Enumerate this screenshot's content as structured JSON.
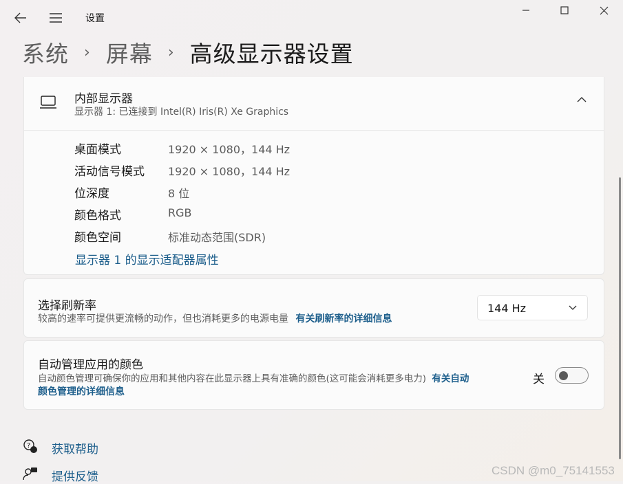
{
  "window": {
    "title": "设置",
    "breadcrumb": [
      "系统",
      "屏幕",
      "高级显示器设置"
    ]
  },
  "display_card": {
    "title": "内部显示器",
    "subtitle": "显示器 1: 已连接到 Intel(R) Iris(R) Xe Graphics",
    "rows": [
      {
        "label": "桌面模式",
        "value": "1920 × 1080，144 Hz"
      },
      {
        "label": "活动信号模式",
        "value": "1920 × 1080，144 Hz"
      },
      {
        "label": "位深度",
        "value": "8 位"
      },
      {
        "label": "颜色格式",
        "value": "RGB"
      },
      {
        "label": "颜色空间",
        "value": "标准动态范围(SDR)"
      }
    ],
    "adapter_link": "显示器 1 的显示适配器属性"
  },
  "refresh_card": {
    "title": "选择刷新率",
    "description": "较高的速率可提供更流畅的动作，但也消耗更多的电源电量",
    "link": "有关刷新率的详细信息",
    "selected": "144 Hz"
  },
  "color_card": {
    "title": "自动管理应用的颜色",
    "description_line1": "自动颜色管理可确保你的应用和其他内容在此显示器上具有准确的颜色(这可能会消耗更多电力)",
    "link_line1": "有关自动",
    "link_line2": "颜色管理的详细信息",
    "toggle_state": "关",
    "toggle_on": false
  },
  "footer": {
    "help": "获取帮助",
    "feedback": "提供反馈"
  },
  "watermark": "CSDN @m0_75141553"
}
